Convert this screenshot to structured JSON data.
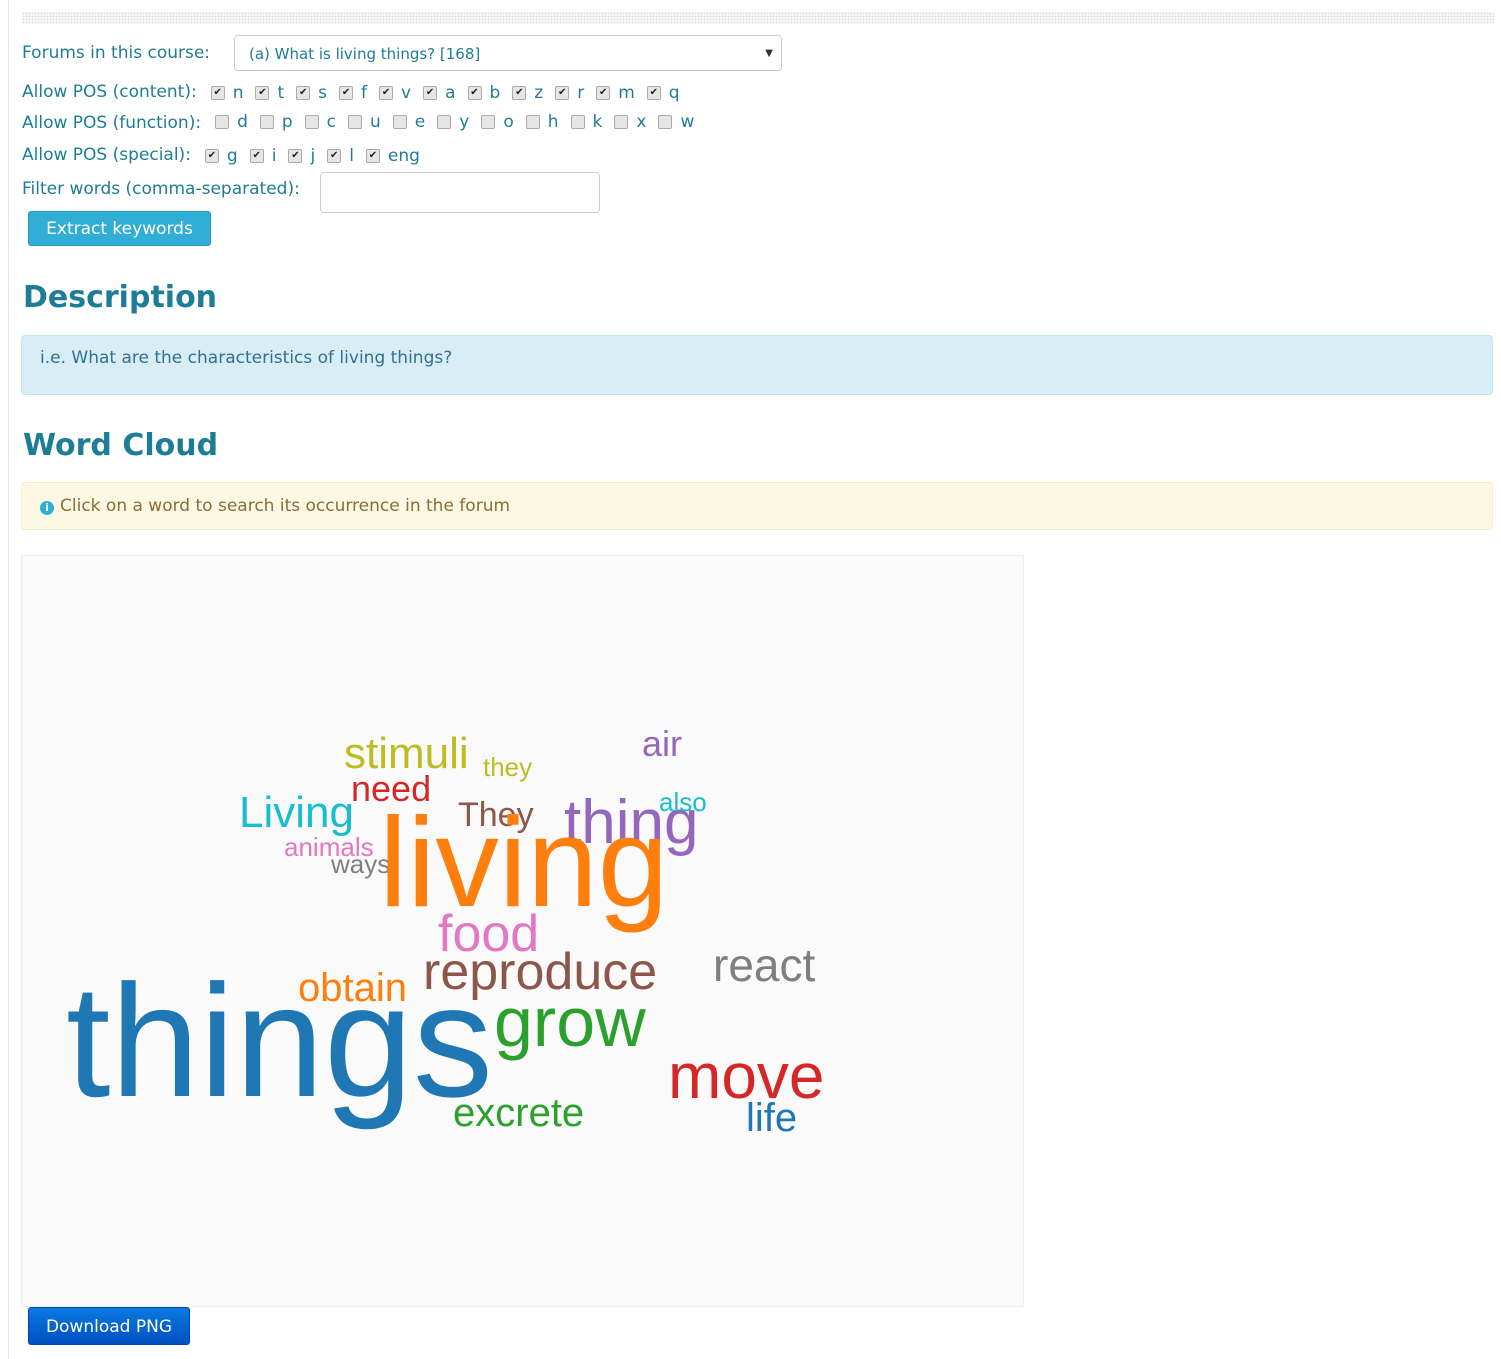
{
  "forums": {
    "label": "Forums in this course:",
    "selected": "(a) What is living things? [168]"
  },
  "pos_content": {
    "label": "Allow POS (content):",
    "items": [
      {
        "tag": "n",
        "checked": true
      },
      {
        "tag": "t",
        "checked": true
      },
      {
        "tag": "s",
        "checked": true
      },
      {
        "tag": "f",
        "checked": true
      },
      {
        "tag": "v",
        "checked": true
      },
      {
        "tag": "a",
        "checked": true
      },
      {
        "tag": "b",
        "checked": true
      },
      {
        "tag": "z",
        "checked": true
      },
      {
        "tag": "r",
        "checked": true
      },
      {
        "tag": "m",
        "checked": true
      },
      {
        "tag": "q",
        "checked": true
      }
    ]
  },
  "pos_function": {
    "label": "Allow POS (function):",
    "items": [
      {
        "tag": "d",
        "checked": false
      },
      {
        "tag": "p",
        "checked": false
      },
      {
        "tag": "c",
        "checked": false
      },
      {
        "tag": "u",
        "checked": false
      },
      {
        "tag": "e",
        "checked": false
      },
      {
        "tag": "y",
        "checked": false
      },
      {
        "tag": "o",
        "checked": false
      },
      {
        "tag": "h",
        "checked": false
      },
      {
        "tag": "k",
        "checked": false
      },
      {
        "tag": "x",
        "checked": false
      },
      {
        "tag": "w",
        "checked": false
      }
    ]
  },
  "pos_special": {
    "label": "Allow POS (special):",
    "items": [
      {
        "tag": "g",
        "checked": true
      },
      {
        "tag": "i",
        "checked": true
      },
      {
        "tag": "j",
        "checked": true
      },
      {
        "tag": "l",
        "checked": true
      },
      {
        "tag": "eng",
        "checked": true
      }
    ]
  },
  "filter": {
    "label": "Filter words (comma-separated):",
    "value": ""
  },
  "extract_label": "Extract keywords",
  "description": {
    "heading": "Description",
    "text": "i.e. What are the characteristics of living things?"
  },
  "wordcloud": {
    "heading": "Word Cloud",
    "hint": "Click on a word to search its occurrence in the forum",
    "words": [
      {
        "text": "stimuli",
        "color": "#bcbd22"
      },
      {
        "text": "they",
        "color": "#bcbd22"
      },
      {
        "text": "air",
        "color": "#9467bd"
      },
      {
        "text": "need",
        "color": "#d62728"
      },
      {
        "text": "Living",
        "color": "#17becf"
      },
      {
        "text": "They",
        "color": "#8c564b"
      },
      {
        "text": "thing",
        "color": "#9467bd"
      },
      {
        "text": "also",
        "color": "#17becf"
      },
      {
        "text": "animals",
        "color": "#e377c2"
      },
      {
        "text": "ways",
        "color": "#7f7f7f"
      },
      {
        "text": "living",
        "color": "#ff7f0e"
      },
      {
        "text": "food",
        "color": "#e377c2"
      },
      {
        "text": "reproduce",
        "color": "#8c564b"
      },
      {
        "text": "react",
        "color": "#7f7f7f"
      },
      {
        "text": "obtain",
        "color": "#ff7f0e"
      },
      {
        "text": "things",
        "color": "#1f77b4"
      },
      {
        "text": "grow",
        "color": "#2ca02c"
      },
      {
        "text": "move",
        "color": "#d62728"
      },
      {
        "text": "excrete",
        "color": "#2ca02c"
      },
      {
        "text": "life",
        "color": "#1f77b4"
      }
    ]
  },
  "download_label": "Download PNG"
}
